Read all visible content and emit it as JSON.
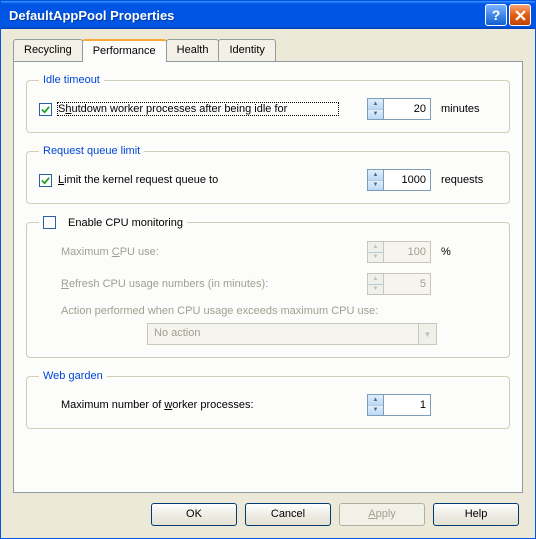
{
  "window": {
    "title": "DefaultAppPool Properties"
  },
  "tabs": {
    "recycling": "Recycling",
    "performance": "Performance",
    "health": "Health",
    "identity": "Identity"
  },
  "idle": {
    "legend": "Idle timeout",
    "label_pre": "S",
    "label_ul": "h",
    "label_post": "utdown worker processes after being idle for",
    "value": "20",
    "unit": "minutes"
  },
  "queue": {
    "legend": "Request queue limit",
    "label_pre": "",
    "label_ul": "L",
    "label_post": "imit the kernel request queue to",
    "value": "1000",
    "unit": "requests"
  },
  "cpu": {
    "legend_pre": "",
    "legend_ul": "E",
    "legend_post": "nable CPU monitoring",
    "max_pre": "Maximum ",
    "max_ul": "C",
    "max_post": "PU use:",
    "max_value": "100",
    "max_unit": "%",
    "refresh_pre": "",
    "refresh_ul": "R",
    "refresh_post": "efresh CPU usage numbers (in minutes):",
    "refresh_value": "5",
    "action_label": "Action performed when CPU usage exceeds maximum CPU use:",
    "action_value": "No action"
  },
  "garden": {
    "legend": "Web garden",
    "label_pre": "Maximum number of ",
    "label_ul": "w",
    "label_post": "orker processes:",
    "value": "1"
  },
  "buttons": {
    "ok": "OK",
    "cancel": "Cancel",
    "apply_ul": "A",
    "apply_post": "pply",
    "help": "Help"
  }
}
